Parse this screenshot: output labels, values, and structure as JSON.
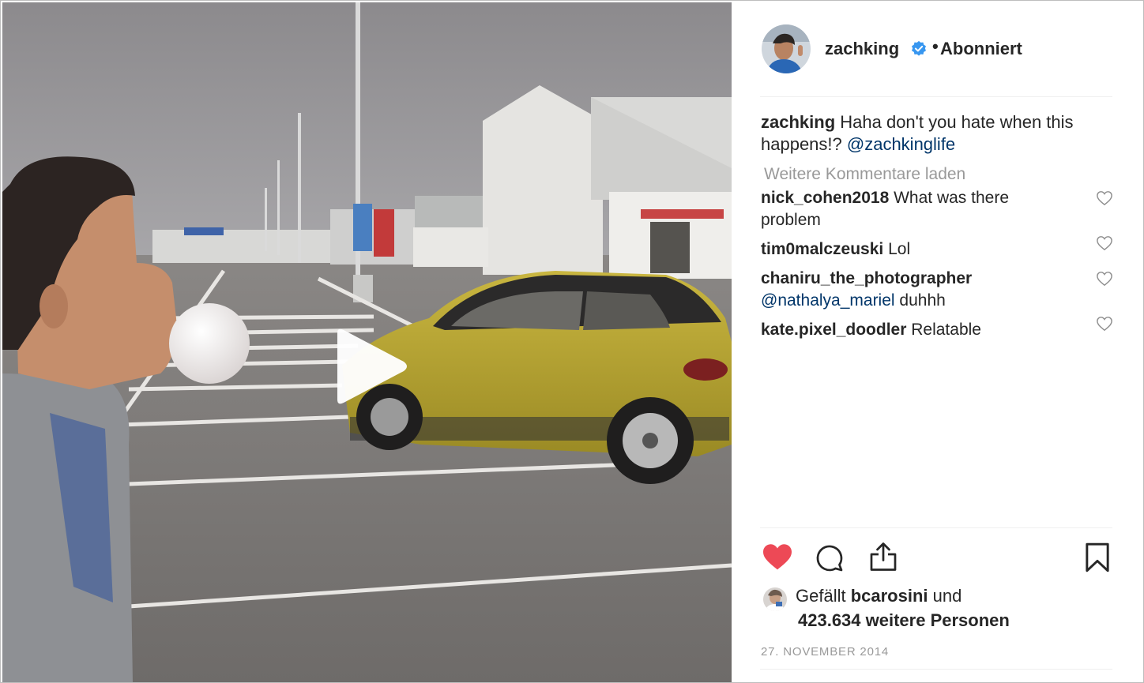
{
  "post": {
    "author": "zachking",
    "follow_status": "Abonniert",
    "separator": "•",
    "caption_text": " Haha don't you hate when this happens!? ",
    "caption_mention": "@zachkinglife",
    "load_more": "Weitere Kommentare laden",
    "date": "27. November 2014"
  },
  "comments": [
    {
      "user": "nick_cohen2018",
      "text": " What was there problem",
      "mention": ""
    },
    {
      "user": "tim0malczeuski",
      "text": " Lol",
      "mention": ""
    },
    {
      "user": "chaniru_the_photographer",
      "text": " duhhh",
      "mention": "@nathalya_mariel"
    },
    {
      "user": "kate.pixel_doodler",
      "text": " Relatable",
      "mention": ""
    }
  ],
  "likes": {
    "prefix": "Gefällt ",
    "user": "bcarosini",
    "suffix": " und",
    "count_text": "423.634 weitere Personen"
  },
  "colors": {
    "heart_active": "#ed4956",
    "mention": "#003569",
    "muted": "#999999",
    "verified": "#3897f0"
  },
  "icons": [
    "verified-badge-icon",
    "heart-icon",
    "comment-icon",
    "share-icon",
    "bookmark-icon",
    "play-icon"
  ]
}
